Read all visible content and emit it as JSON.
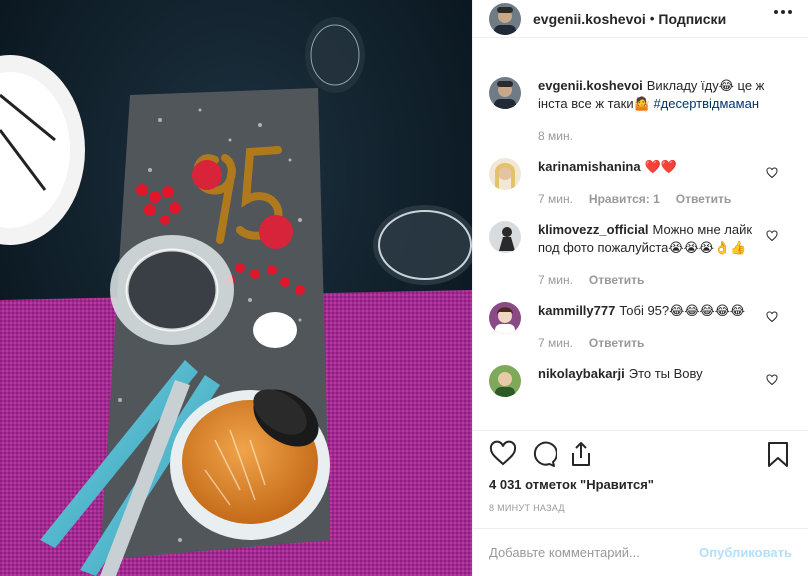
{
  "header": {
    "username": "evgenii.koshevoi",
    "separator": "•",
    "follow_label": "Подписки"
  },
  "caption": {
    "username": "evgenii.koshevoi",
    "text": "Викладу їду😂 це ж інста все ж таки🤷",
    "hashtag": "#десертвідмаман",
    "time": "8 мин."
  },
  "comments": [
    {
      "username": "karinamishanina",
      "text": "❤️❤️",
      "time": "7 мин.",
      "likes": "Нравится: 1",
      "reply": "Ответить"
    },
    {
      "username": "klimovezz_official",
      "text": "Можно мне лайк под фото пожалуйста😭😭😭👌👍",
      "time": "7 мин.",
      "reply": "Ответить"
    },
    {
      "username": "kammilly777",
      "text": "Тобі 95?😂😂😂😂😂",
      "time": "7 мин.",
      "reply": "Ответить"
    },
    {
      "username": "nikolaybakarji",
      "text": "Это ты Вову"
    }
  ],
  "actions": {
    "like_icon": "heart-outline-icon",
    "comment_icon": "speech-bubble-icon",
    "share_icon": "share-arrow-icon",
    "save_icon": "bookmark-icon"
  },
  "likes_text": "4 031 отметок \"Нравится\"",
  "posted_time": "8 МИНУТ НАЗАД",
  "add_comment": {
    "placeholder": "Добавьте комментарий...",
    "post_label": "Опубликовать"
  },
  "colors": {
    "link": "#003569",
    "muted": "#999999",
    "post_disabled": "#b2dffc",
    "tablecloth": "#a0278d"
  }
}
